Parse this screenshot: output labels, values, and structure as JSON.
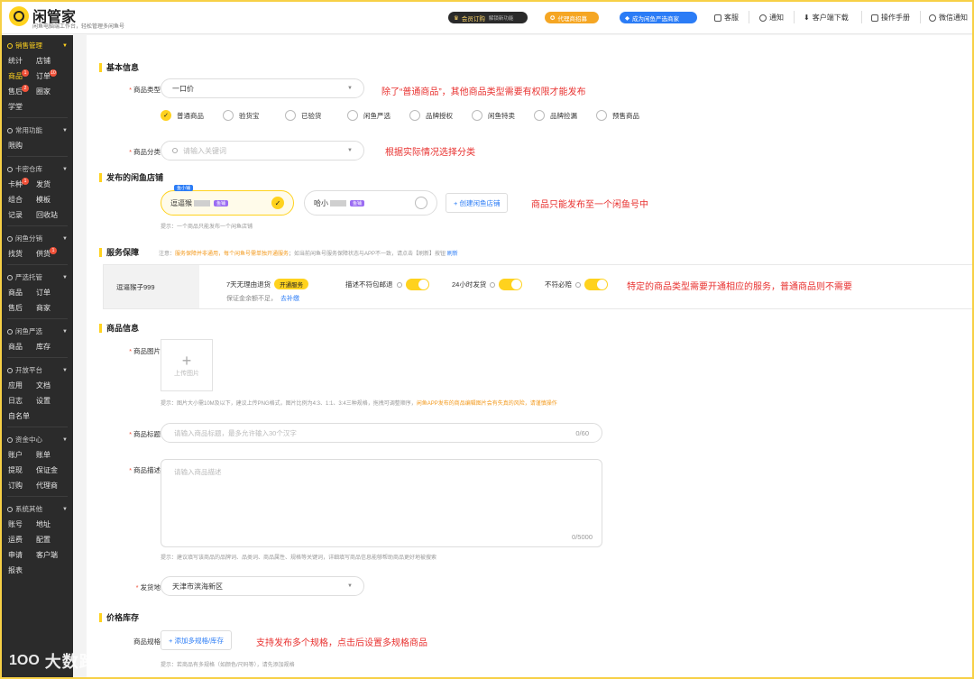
{
  "app": {
    "brand": "闲管家",
    "brand_sub": "闲鱼电脑端工作台，轻松管理多闲鱼号"
  },
  "topbar": {
    "vip_label": "会员订购",
    "vip_sub": "解锁新功能",
    "agent_label": "代理商招募",
    "yanxuan_label": "成为闲鱼严选商家",
    "links": [
      "客服",
      "通知",
      "客户端下载",
      "操作手册",
      "微信通知"
    ]
  },
  "sidebar": {
    "sections": [
      {
        "title": "销售管理",
        "active": true,
        "items": [
          {
            "label": "统计"
          },
          {
            "label": "店铺"
          },
          {
            "label": "商品",
            "active": true,
            "badge": "1"
          },
          {
            "label": "订单",
            "badge": "10"
          },
          {
            "label": "售后",
            "badge": "2"
          },
          {
            "label": "圈家"
          },
          {
            "label": "学堂"
          }
        ]
      },
      {
        "title": "常用功能",
        "items": [
          {
            "label": "限购"
          }
        ]
      },
      {
        "title": "卡密仓库",
        "items": [
          {
            "label": "卡种",
            "badge": "1"
          },
          {
            "label": "发货"
          },
          {
            "label": "组合"
          },
          {
            "label": "模板"
          },
          {
            "label": "记录"
          },
          {
            "label": "回收站"
          }
        ]
      },
      {
        "title": "闲鱼分销",
        "items": [
          {
            "label": "找货"
          },
          {
            "label": "供货",
            "badge": "1"
          }
        ]
      },
      {
        "title": "严选托管",
        "items": [
          {
            "label": "商品"
          },
          {
            "label": "订单"
          },
          {
            "label": "售后"
          },
          {
            "label": "商家"
          }
        ]
      },
      {
        "title": "闲鱼严选",
        "items": [
          {
            "label": "商品"
          },
          {
            "label": "库存"
          }
        ]
      },
      {
        "title": "开放平台",
        "items": [
          {
            "label": "应用"
          },
          {
            "label": "文档"
          },
          {
            "label": "日志"
          },
          {
            "label": "设置"
          },
          {
            "label": "自名单"
          }
        ]
      },
      {
        "title": "资金中心",
        "items": [
          {
            "label": "账户"
          },
          {
            "label": "账单"
          },
          {
            "label": "提现"
          },
          {
            "label": "保证金"
          },
          {
            "label": "订购"
          },
          {
            "label": "代理商"
          }
        ]
      },
      {
        "title": "系统其他",
        "items": [
          {
            "label": "账号"
          },
          {
            "label": "地址"
          },
          {
            "label": "运费"
          },
          {
            "label": "配置"
          },
          {
            "label": "申请"
          },
          {
            "label": "客户端"
          },
          {
            "label": "报表"
          }
        ]
      }
    ]
  },
  "form": {
    "basic_title": "基本信息",
    "type_label": "商品类型",
    "type_value": "一口价",
    "type_annot": "除了“普通商品”，其他商品类型需要有权限才能发布",
    "types": [
      {
        "label": "普通商品",
        "checked": true
      },
      {
        "label": "验货宝"
      },
      {
        "label": "已验货"
      },
      {
        "label": "闲鱼严选"
      },
      {
        "label": "品牌授权"
      },
      {
        "label": "闲鱼特卖"
      },
      {
        "label": "品牌捡漏"
      },
      {
        "label": "预售商品"
      }
    ],
    "category_label": "商品分类",
    "category_placeholder": "请输入关键词",
    "category_annot": "根据实际情况选择分类",
    "store_title": "发布的闲鱼店铺",
    "store_flag": "鱼小铺",
    "store1_name": "逗逼猴",
    "store1_tag": "鱼铺",
    "store2_name": "哈小",
    "store2_tag": "鱼铺",
    "create_store": "+ 创建闲鱼店铺",
    "store_annot": "商品只能发布至一个闲鱼号中",
    "store_hint": "提示：一个商品只能发布一个闲鱼店铺",
    "service_title": "服务保障",
    "service_note_prefix": "注意：",
    "service_note_warn": "服务保障并非通用，每个闲鱼号需单独开通服务",
    "service_note_rest": "；如当前闲鱼号服务保障状态与APP不一致，请点击【刷新】按钮",
    "service_note_link": "刷新",
    "service_store": "逗逼猴子999",
    "svc1_label": "7天无理由退货",
    "svc1_btn": "开通服务",
    "svc1_sub": "保证金余额不足，",
    "svc1_sub_link": "去补缴",
    "svc2_label": "描述不符包邮退",
    "svc3_label": "24小时发货",
    "svc4_label": "不符必赔",
    "service_annot": "特定的商品类型需要开通相应的服务，普通商品则不需要",
    "product_title": "商品信息",
    "image_label": "商品图片",
    "upload_label": "上传图片",
    "image_hint": "提示：图片大小需10M及以下，建议上传PNG格式，图片比例为4:3、1:1、3:4三种规格，拖拽可调整顺序，",
    "image_hint_warn": "闲鱼APP发布的商品编辑图片会有失真的风险，请谨慎操作",
    "title_label": "商品标题",
    "title_placeholder": "请输入商品标题，最多允许输入30个汉字",
    "title_count": "0/60",
    "desc_label": "商品描述",
    "desc_placeholder": "请输入商品描述",
    "desc_count": "0/5000",
    "desc_hint": "提示：建议填写该商品的品牌词、品类词、商品属性、规格等关键词，详细填写商品信息能够帮助商品更好地被搜索",
    "ship_label": "发货地",
    "ship_value": "天津市滨海新区",
    "price_title": "价格库存",
    "spec_label": "商品规格",
    "spec_btn": "+ 添加多规格/库存",
    "spec_annot": "支持发布多个规格，点击后设置多规格商品",
    "spec_hint": "提示：若商品有多规格（如颜色/尺码等），请先添加规格"
  },
  "watermark": {
    "logo": "1OO",
    "text": "大数跨境"
  },
  "colors": {
    "accent": "#ffd21e",
    "sidebar": "#2b2b2b",
    "annot": "#e8312f",
    "link": "#2b7cf6"
  }
}
